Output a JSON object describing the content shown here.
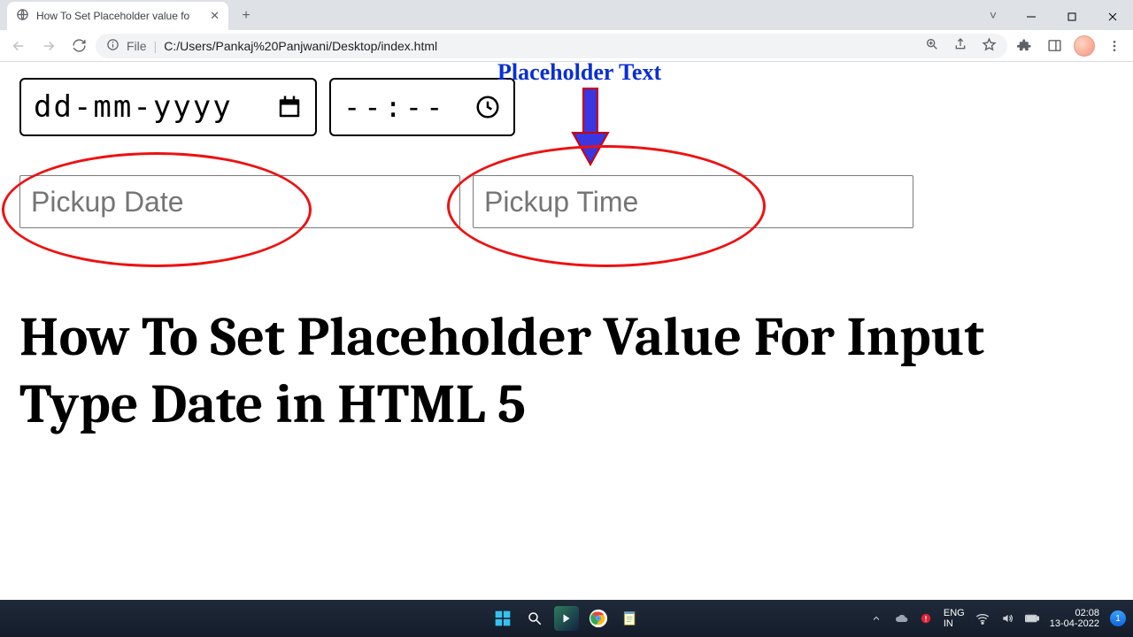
{
  "browser": {
    "tab_title": "How To Set Placeholder value fo",
    "url_prefix": "File",
    "url": "C:/Users/Pankaj%20Panjwani/Desktop/index.html"
  },
  "page": {
    "native_date_placeholder": "dd-mm-yyyy",
    "native_time_placeholder": "--:--",
    "pickup_date_placeholder": "Pickup Date",
    "pickup_time_placeholder": "Pickup Time",
    "annotation_label": "Placeholder Text",
    "heading": "How To Set Placeholder Value For Input Type Date in HTML 5"
  },
  "taskbar": {
    "lang_top": "ENG",
    "lang_bottom": "IN",
    "time": "02:08",
    "date": "13-04-2022",
    "notif_count": "1"
  }
}
